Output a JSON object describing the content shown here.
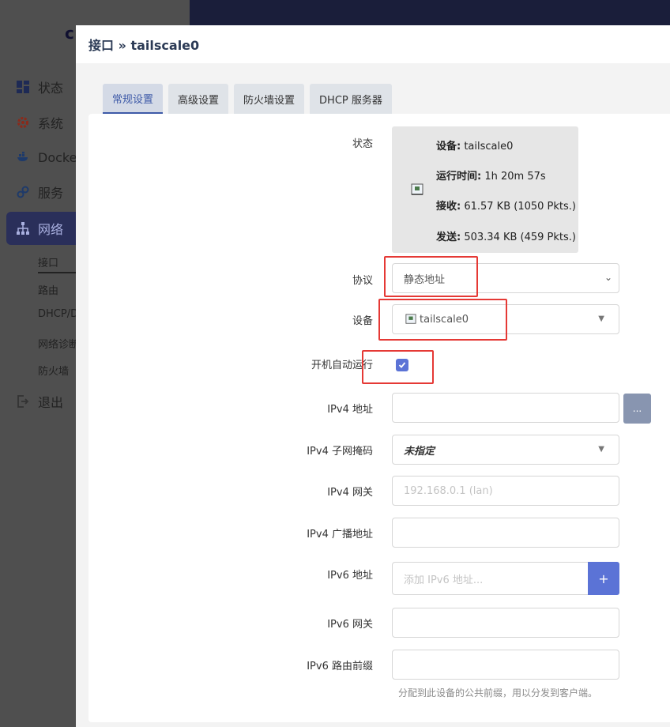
{
  "background": {
    "nav": [
      {
        "label": "状态",
        "icon": "dashboard-icon"
      },
      {
        "label": "系统",
        "icon": "gear-icon"
      },
      {
        "label": "Docker",
        "icon": "docker-icon"
      },
      {
        "label": "服务",
        "icon": "services-icon"
      },
      {
        "label": "网络",
        "icon": "network-icon"
      },
      {
        "label": "退出",
        "icon": "logout-icon"
      }
    ],
    "subnav": [
      "接口",
      "路由",
      "DHCP/D",
      "网络诊断",
      "防火墙"
    ]
  },
  "modal": {
    "title": "接口 » tailscale0",
    "tabs": [
      "常规设置",
      "高级设置",
      "防火墙设置",
      "DHCP 服务器"
    ],
    "status": {
      "label": "状态",
      "device_key": "设备:",
      "device_val": " tailscale0",
      "uptime_key": "运行时间:",
      "uptime_val": " 1h 20m 57s",
      "rx_key": "接收:",
      "rx_val": " 61.57 KB (1050 Pkts.)",
      "tx_key": "发送:",
      "tx_val": " 503.34 KB (459 Pkts.)"
    },
    "fields": {
      "protocol_label": "协议",
      "protocol_value": "静态地址",
      "device_label": "设备",
      "device_value": "tailscale0",
      "autostart_label": "开机自动运行",
      "ipv4_addr_label": "IPv4 地址",
      "ipv4_addr_btn": "...",
      "ipv4_mask_label": "IPv4 子网掩码",
      "ipv4_mask_value": "未指定",
      "ipv4_gw_label": "IPv4 网关",
      "ipv4_gw_placeholder": "192.168.0.1 (lan)",
      "ipv4_bcast_label": "IPv4 广播地址",
      "ipv6_addr_label": "IPv6 地址",
      "ipv6_addr_placeholder": "添加 IPv6 地址...",
      "ipv6_addr_btn": "+",
      "ipv6_gw_label": "IPv6 网关",
      "ipv6_prefix_label": "IPv6 路由前缀",
      "ipv6_prefix_hint": "分配到此设备的公共前缀，用以分发到客户端。"
    }
  },
  "colors": {
    "accent": "#5b73d6",
    "highlight": "#e53935",
    "topbar": "#1a1e3a"
  }
}
